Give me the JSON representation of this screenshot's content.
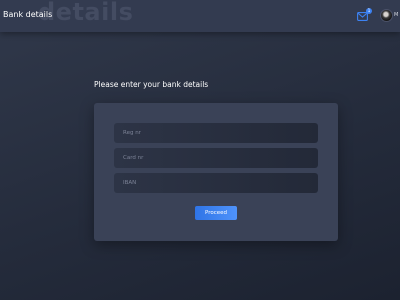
{
  "header": {
    "title": "Bank details",
    "watermark": "details",
    "mail_badge_count": "1",
    "user_name": "M"
  },
  "icons": {
    "mail": "envelope-icon",
    "avatar": "user-avatar"
  },
  "form": {
    "prompt": "Please enter your bank details",
    "fields": [
      {
        "placeholder": "Reg nr",
        "value": ""
      },
      {
        "placeholder": "Card nr",
        "value": ""
      },
      {
        "placeholder": "IBAN",
        "value": ""
      }
    ],
    "submit_label": "Proceed"
  },
  "colors": {
    "accent": "#3d82f2",
    "background": "#2a3143",
    "card": "#3a4257"
  }
}
